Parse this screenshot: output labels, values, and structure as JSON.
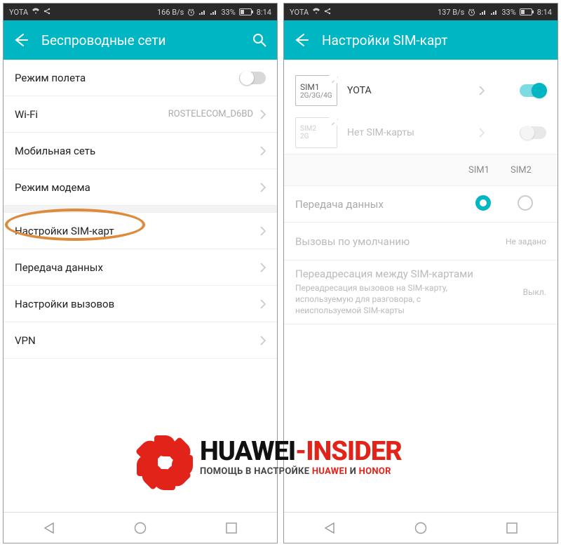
{
  "left": {
    "status": {
      "carrier": "YOTA",
      "speed": "166 B/s",
      "battery_pct": "33%",
      "time": "8:14"
    },
    "header": {
      "title": "Беспроводные сети"
    },
    "rows": {
      "airplane": "Режим полета",
      "wifi": "Wi-Fi",
      "wifi_value": "ROSTELECOM_D6BD",
      "mobile": "Мобильная сеть",
      "tether": "Режим модема",
      "sim": "Настройки SIM-карт",
      "data": "Передача данных",
      "calls": "Настройки вызовов",
      "vpn": "VPN"
    }
  },
  "right": {
    "status": {
      "carrier": "YOTA",
      "speed": "137 B/s",
      "battery_pct": "33%",
      "time": "8:14"
    },
    "header": {
      "title": "Настройки SIM-карт"
    },
    "sim1": {
      "slot": "SIM1",
      "bands": "2G/3G/4G",
      "name": "YOTA"
    },
    "sim2": {
      "slot": "SIM2",
      "bands": "2G",
      "name": "Нет SIM-карты"
    },
    "cols": {
      "c1": "SIM1",
      "c2": "SIM2"
    },
    "data_row": "Передача данных",
    "default_calls": {
      "label": "Вызовы по умолчанию",
      "value": "Не задано"
    },
    "fwd": {
      "title": "Переадресация между SIM-картами",
      "sub": "Переадресация вызовов на SIM-карту, используемую для разговора, с неиспользуемой SIM-карты",
      "value": "Выкл."
    }
  },
  "watermark": {
    "brand_a": "HUAWEI",
    "brand_b": "-INSIDER",
    "sub_a": "ПОМОЩЬ В НАСТРОЙКЕ ",
    "sub_b": "HUAWEI",
    "sub_c": " И ",
    "sub_d": "HONOR"
  }
}
